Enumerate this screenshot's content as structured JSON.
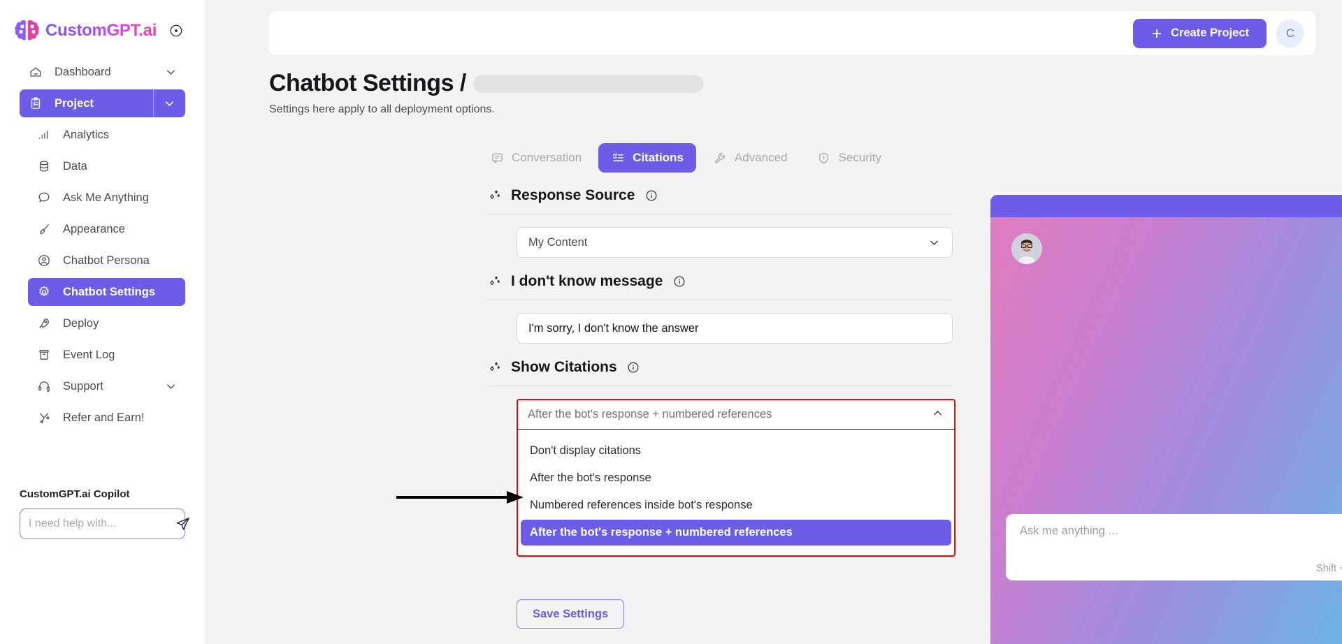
{
  "brand": {
    "name": "CustomGPT.ai",
    "toggle_icon": "collapse-circle-icon"
  },
  "sidebar": {
    "items": [
      {
        "label": "Dashboard",
        "icon": "home-icon",
        "has_chevron": true,
        "active": false,
        "sub": false
      },
      {
        "label": "Project",
        "icon": "clipboard-icon",
        "has_chevron": true,
        "active": true,
        "sub": false
      },
      {
        "label": "Analytics",
        "icon": "bar-chart-icon",
        "has_chevron": false,
        "active": false,
        "sub": true
      },
      {
        "label": "Data",
        "icon": "database-icon",
        "has_chevron": false,
        "active": false,
        "sub": true
      },
      {
        "label": "Ask Me Anything",
        "icon": "chat-bubble-icon",
        "has_chevron": false,
        "active": false,
        "sub": true
      },
      {
        "label": "Appearance",
        "icon": "paintbrush-icon",
        "has_chevron": false,
        "active": false,
        "sub": true
      },
      {
        "label": "Chatbot Persona",
        "icon": "user-circle-icon",
        "has_chevron": false,
        "active": false,
        "sub": true
      },
      {
        "label": "Chatbot Settings",
        "icon": "gear-icon",
        "has_chevron": false,
        "active": true,
        "sub": true
      },
      {
        "label": "Deploy",
        "icon": "rocket-icon",
        "has_chevron": false,
        "active": false,
        "sub": true
      },
      {
        "label": "Event Log",
        "icon": "archive-icon",
        "has_chevron": false,
        "active": false,
        "sub": true
      },
      {
        "label": "Support",
        "icon": "headset-icon",
        "has_chevron": true,
        "active": false,
        "sub": true
      },
      {
        "label": "Refer and Earn!",
        "icon": "share-nodes-icon",
        "has_chevron": false,
        "active": false,
        "sub": true
      }
    ],
    "copilot": {
      "title": "CustomGPT.ai Copilot",
      "placeholder": "I need help with...",
      "value": "",
      "send_icon": "send-paper-plane-icon"
    }
  },
  "topbar": {
    "create_label": "Create Project",
    "plus_icon": "plus-icon",
    "avatar_initial": "C"
  },
  "page": {
    "title": "Chatbot Settings /",
    "project_name_redacted": true,
    "subtitle": "Settings here apply to all deployment options."
  },
  "tabs": [
    {
      "label": "Conversation",
      "icon": "speech-bubble-icon",
      "active": false
    },
    {
      "label": "Citations",
      "icon": "quote-list-icon",
      "active": true
    },
    {
      "label": "Advanced",
      "icon": "wrench-icon",
      "active": false
    },
    {
      "label": "Security",
      "icon": "shield-check-icon",
      "active": false
    }
  ],
  "sections": {
    "response_source": {
      "title": "Response Source",
      "info_icon": "info-circle-icon",
      "deco_icon": "sparkle-diamonds-icon",
      "selected": "My Content",
      "caret_icon": "chevron-down-icon"
    },
    "i_dont_know": {
      "title": "I don't know message",
      "info_icon": "info-circle-icon",
      "deco_icon": "sparkle-diamonds-icon",
      "value": "I'm sorry, I don't know the answer",
      "placeholder": "I'm sorry, I don't know the answer"
    },
    "show_citations": {
      "title": "Show Citations",
      "info_icon": "info-circle-icon",
      "deco_icon": "sparkle-diamonds-icon",
      "selected": "After the bot's response + numbered references",
      "caret_icon": "chevron-up-icon",
      "expanded": true,
      "options": [
        "Don't display citations",
        "After the bot's response",
        "Numbered references inside bot's response",
        "After the bot's response + numbered references"
      ],
      "selected_index": 3
    }
  },
  "save": {
    "label": "Save Settings"
  },
  "chat_preview": {
    "refresh_icon": "refresh-icon",
    "close_icon": "close-x-icon",
    "avatar_icon": "user-photo-avatar",
    "input_placeholder": "Ask me anything ...",
    "input_value": "",
    "hint": "Shift + Enter to add a new line",
    "send_icon": "send-paper-plane-icon",
    "fab_icon": "support-agent-photo"
  },
  "annotation": {
    "arrow_icon": "pointer-arrow-icon",
    "highlight_color": "#ff0000"
  },
  "colors": {
    "accent": "#6c5ce7",
    "accent_soft": "#8b7cf0",
    "highlight_red": "#ff0000",
    "page_bg": "#f3f3f4",
    "panel_bg": "#ffffff",
    "text": "#16171b",
    "muted": "#a7a9b0"
  }
}
